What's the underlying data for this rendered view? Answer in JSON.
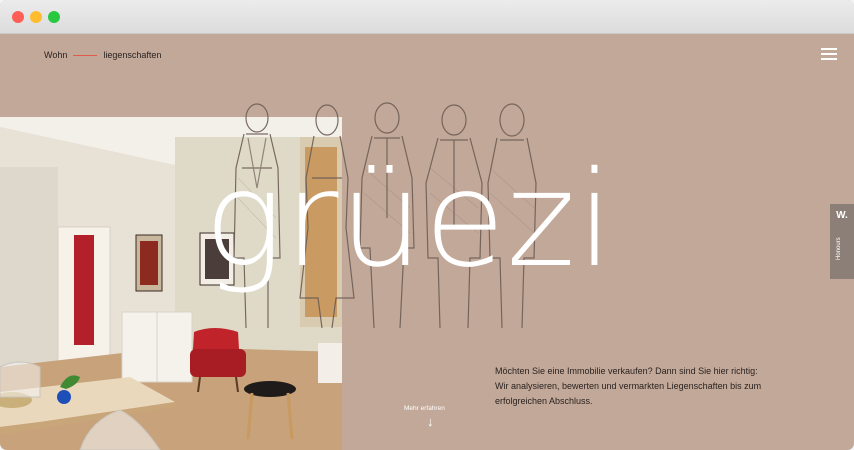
{
  "window": {
    "controls": [
      "close",
      "minimize",
      "zoom"
    ]
  },
  "brand": {
    "part1": "Wohn",
    "part2": "liegenschaften"
  },
  "menu": {
    "icon": "hamburger-icon"
  },
  "hero": {
    "title": "grüezi"
  },
  "side_tab": {
    "logo": "W.",
    "label": "Honours"
  },
  "intro": {
    "line1": "Möchten Sie eine Immobilie verkaufen? Dann sind Sie hier richtig:",
    "line2": "Wir analysieren, bewerten und vermarkten Liegenschaften bis zum",
    "line3": "erfolgreichen Abschluss."
  },
  "more": {
    "label": "Mehr erfahren",
    "arrow": "↓"
  },
  "colors": {
    "background": "#c2a898",
    "accent_line": "#e05a4e",
    "chair": "#c0242a"
  }
}
